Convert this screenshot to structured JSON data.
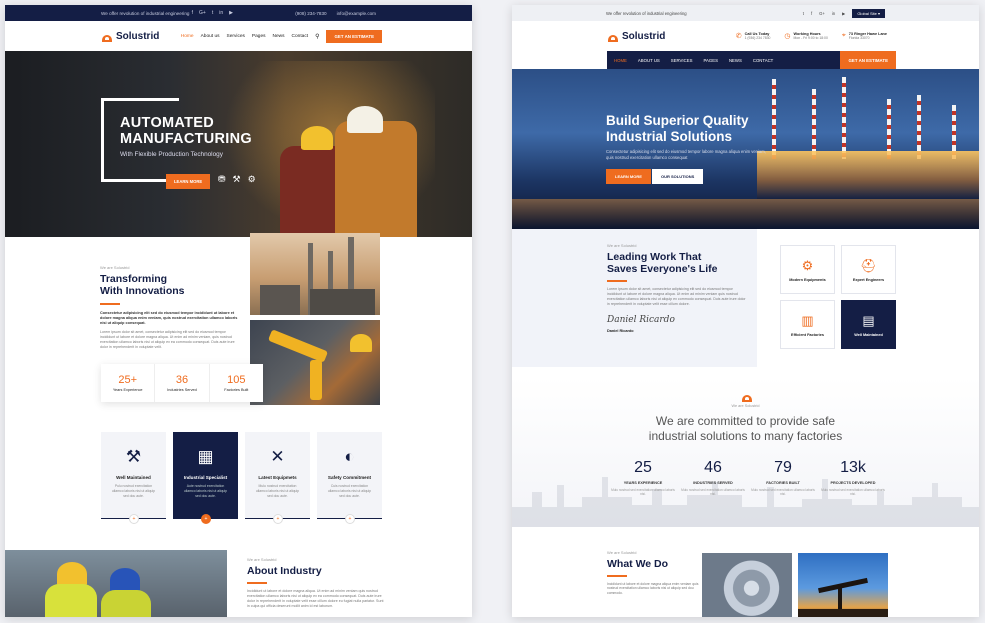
{
  "left": {
    "topbar": {
      "tagline": "We offer revolution of industrial engineering",
      "socials": [
        "f",
        "G+",
        "t",
        "in",
        "▶"
      ],
      "phone": "(908) 234-7830",
      "email": "info@example.com"
    },
    "nav": {
      "brand": "Solustrid",
      "items": [
        "Home",
        "About us",
        "Services",
        "Pages",
        "News",
        "Contact"
      ],
      "cta": "GET AN ESTIMATE"
    },
    "hero": {
      "title_line1": "AUTOMATED",
      "title_line2": "MANUFACTURING",
      "subtitle": "With Flexible Production Technology",
      "button": "LEARN MORE"
    },
    "about": {
      "eyebrow": "We are Solustrid",
      "title_line1": "Transforming",
      "title_line2": "With Innovations",
      "lead": "Consectetur adipisicing elit sed do eiusmod tempor incididunt ut labore et dolore magna aliqua enim veniam, quis nostrud exercitation ullamco laboris nisi ut aliquip consequat.",
      "body": "Lorem ipsum dolor sit amet, consectetur adipisicing elit sed do eiusmod tempor incididunt ut labore et dolore magna aliqua. Ut enim ad minim veniam, quis nostrud exercitation ullamco laboris nisi ut aliquip ex ea commodo consequat. Duis aute irure dolor in reprehenderit in voluptate velit."
    },
    "stats": [
      {
        "num": "25+",
        "label": "Years Experience"
      },
      {
        "num": "36",
        "label": "Industries Served"
      },
      {
        "num": "105",
        "label": "Factories Built"
      }
    ],
    "features": [
      {
        "title": "Well Maintained",
        "desc": "Pulu nostrud exercitation ullamco laboris nisi ut aliquip sed dou aute."
      },
      {
        "title": "Industrial Specialist",
        "desc": "Aute nostrud exercitation ullamco laboris nisi ut aliquip sed dou aute."
      },
      {
        "title": "Latest Equipmets",
        "desc": "Mulu nostrud exercitation ullamco laboris nisi ut aliquip sed dou aute."
      },
      {
        "title": "Safety Commitment",
        "desc": "Cuis nostrud exercitation ullamco laboris nisi ut aliquip sed dou aute."
      }
    ],
    "industry": {
      "eyebrow": "We are Solustrid",
      "title": "About Industry",
      "body": "Incididunt ut labore et dolore magna aliqua. Ut enim ad minim veniam quis nostrud exercitation ullamco laboris nisi ut aliquip ex ea commodo consequat. Duis aute irure dolor in reprehenderit in voluptate velit esse cillum dolore eu fugiat nulla pariatur. Sunt in culpa qui officia deserunt mollit anim id est laborum."
    }
  },
  "right": {
    "topbar": {
      "tagline": "We offer revolution of industrial engineering",
      "socials": [
        "t",
        "f",
        "G+",
        "in",
        "▶"
      ],
      "global": "Global Site ▾"
    },
    "header": {
      "brand": "Solustrid",
      "info": [
        {
          "icon": "✆",
          "k": "Call Us Today",
          "v": "1 (936) 234 7830"
        },
        {
          "icon": "◷",
          "k": "Working Hours",
          "v": "Mon - Fri 9:00 to 18:00"
        },
        {
          "icon": "⌖",
          "k": "73 Ringer Hawe Lane",
          "v": "Florida 33070"
        }
      ]
    },
    "menu": {
      "items": [
        "HOME",
        "ABOUT US",
        "SERVICES",
        "PAGES",
        "NEWS",
        "CONTACT"
      ],
      "cta": "GET AN ESTIMATE"
    },
    "hero": {
      "title_line1": "Build Superior Quality",
      "title_line2": "Industrial Solutions",
      "subtitle": "Consectetur adipisicing elit sed do eiusmod tempor labore magna aliqua enim veniam, quis nostrud exercitation ullamco consequat",
      "btn1": "LEARN MORE",
      "btn2": "OUR SOLUTIONS"
    },
    "work": {
      "eyebrow": "We are Solustrid",
      "title_line1": "Leading Work That",
      "title_line2": "Saves Everyone's Life",
      "body": "Lorem ipsum dolor sit amet, consectetur adipisicing elit sed do eiusmod tempor incididunt ut labore et dolore magna aliqua. Ut enim ad minim veniam quis nostrud exercitation ullamco laboris nisi ut aliquip ex commodo consequat. Duis aute irure dolor in reprehenderit in voluptate velit esse cillum dolore.",
      "signature": "Daniel Ricardo",
      "name": "Daniel Ricardo"
    },
    "tiles": [
      {
        "icon": "⚙",
        "title": "Modern Equipments"
      },
      {
        "icon": "⛑",
        "title": "Expert Engineers"
      },
      {
        "icon": "▥",
        "title": "Efficient Factories"
      },
      {
        "icon": "▤",
        "title": "Well Maintained"
      }
    ],
    "commit": {
      "eyebrow": "We are Solustrid",
      "title_line1": "We are committed to provide safe",
      "title_line2": "industrial solutions to many factories"
    },
    "stats": [
      {
        "num": "25",
        "label": "YEARS EXPERIENCE",
        "desc": "Mulu nostrud sed exercitation ullamco laboris nisi."
      },
      {
        "num": "46",
        "label": "INDUSTRIES SERVED",
        "desc": "Mulu nostrud sed exercitation ullamco laboris nisi."
      },
      {
        "num": "79",
        "label": "FACTORIES BUILT",
        "desc": "Mulu nostrud sed exercitation ullamco laboris nisi."
      },
      {
        "num": "13k",
        "label": "PROJECTS DEVELOPED",
        "desc": "Mulu nostrud sed exercitation ullamco laboris nisi."
      }
    ],
    "what": {
      "eyebrow": "We are Solustrid",
      "title": "What We Do",
      "body": "Incididunt ut labore et dolore magna aliqua enim veniam quis nostrud exercitation ullamco laboris nisi ut aliquip sed dou commodo."
    }
  }
}
